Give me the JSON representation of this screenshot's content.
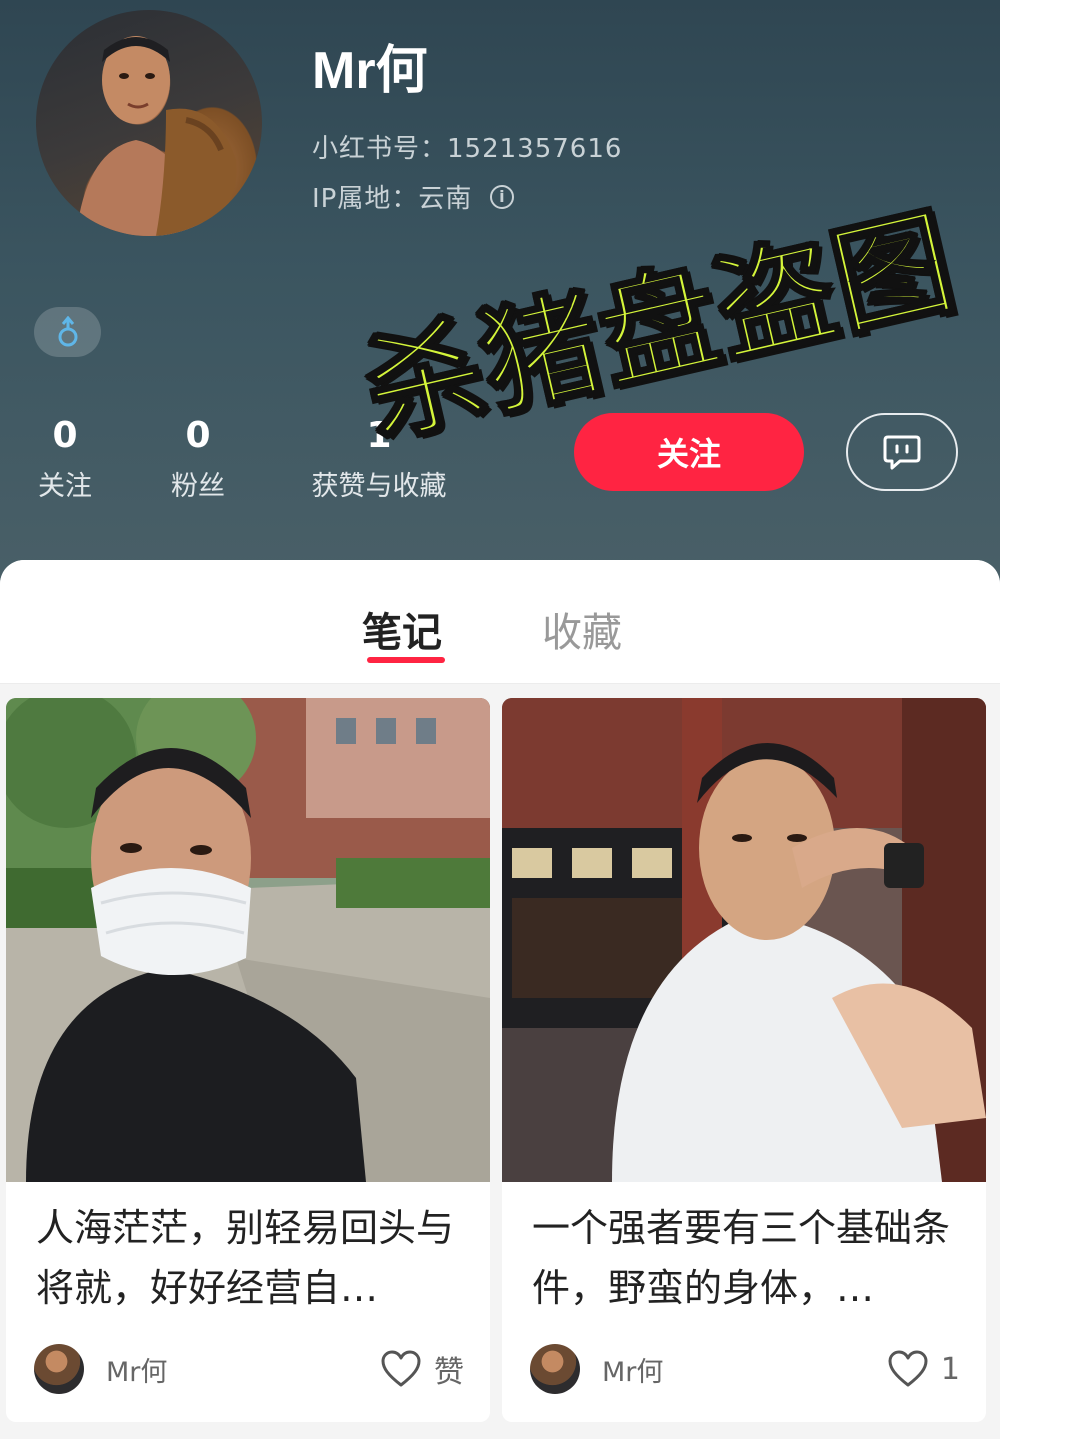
{
  "profile": {
    "name": "Mr何",
    "red_id": "小红书号：1521357616",
    "ip_location": "IP属地：云南",
    "gender_symbol": "♂"
  },
  "watermark": "杀猪盘盗图",
  "stats": {
    "following_count": "0",
    "following_label": "关注",
    "fans_count": "0",
    "fans_label": "粉丝",
    "likes_count": "1",
    "likes_label": "获赞与收藏"
  },
  "actions": {
    "follow_label": "关注"
  },
  "tabs": [
    {
      "label": "笔记",
      "active": true
    },
    {
      "label": "收藏",
      "active": false
    }
  ],
  "notes": [
    {
      "title": "人海茫茫，别轻易回头与将就，好好经营自…",
      "author": "Mr何",
      "like_label": "赞"
    },
    {
      "title": "一个强者要有三个基础条件，野蛮的身体，…",
      "author": "Mr何",
      "like_label": "1"
    }
  ],
  "colors": {
    "accent": "#ff2442",
    "watermark": "#d4f53a",
    "header_bg": "#3b5560"
  },
  "icons": [
    "info-icon",
    "male-icon",
    "chat-icon",
    "heart-icon"
  ]
}
